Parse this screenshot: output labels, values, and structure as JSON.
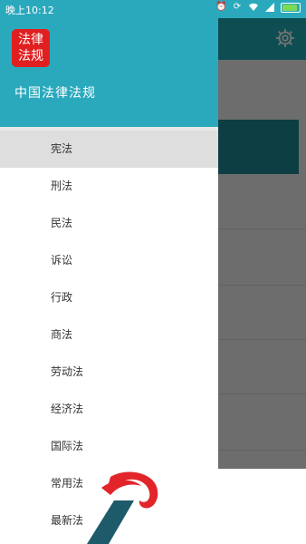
{
  "status_bar": {
    "time": "晚上10:12",
    "icons": [
      "alarm-icon",
      "sync-icon",
      "wifi-icon",
      "signal-icon",
      "battery-icon"
    ],
    "battery_color": "#7ed957"
  },
  "drawer": {
    "logo_line1": "法律",
    "logo_line2": "法规",
    "app_name": "中国法律法规",
    "header_color": "#2aa9bd",
    "menu": [
      {
        "label": "宪法",
        "active": true
      },
      {
        "label": "刑法"
      },
      {
        "label": "民法"
      },
      {
        "label": "诉讼"
      },
      {
        "label": "行政"
      },
      {
        "label": "商法"
      },
      {
        "label": "劳动法"
      },
      {
        "label": "经济法"
      },
      {
        "label": "国际法"
      },
      {
        "label": "常用法"
      },
      {
        "label": "最新法"
      }
    ]
  },
  "background_app": {
    "toolbar_icon": "gear-icon",
    "accent_color": "#21aab6"
  },
  "overlay": {
    "watermark_icon": "brand-logo-watermark"
  }
}
